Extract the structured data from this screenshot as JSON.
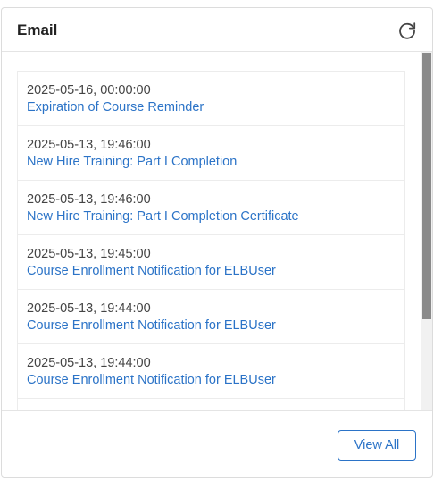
{
  "widget": {
    "title": "Email",
    "refresh_icon": "refresh-icon",
    "view_all_label": "View All"
  },
  "emails": [
    {
      "date": "2025-05-16, 00:00:00",
      "subject": "Expiration of Course Reminder"
    },
    {
      "date": "2025-05-13, 19:46:00",
      "subject": "New Hire Training: Part I Completion"
    },
    {
      "date": "2025-05-13, 19:46:00",
      "subject": "New Hire Training: Part I Completion Certificate"
    },
    {
      "date": "2025-05-13, 19:45:00",
      "subject": "Course Enrollment Notification for ELBUser"
    },
    {
      "date": "2025-05-13, 19:44:00",
      "subject": "Course Enrollment Notification for ELBUser"
    },
    {
      "date": "2025-05-13, 19:44:00",
      "subject": "Course Enrollment Notification for ELBUser"
    }
  ],
  "colors": {
    "link": "#2b73c7",
    "text": "#444444",
    "title": "#222222",
    "scrollbar_thumb": "#8a8a8a"
  }
}
